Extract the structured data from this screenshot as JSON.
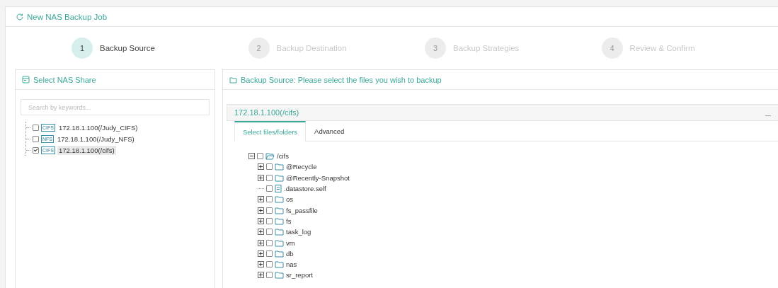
{
  "window": {
    "title": "New NAS Backup Job"
  },
  "steps": [
    {
      "number": "1",
      "label": "Backup Source",
      "selected": true
    },
    {
      "number": "2",
      "label": "Backup Destination",
      "selected": false
    },
    {
      "number": "3",
      "label": "Backup Strategies",
      "selected": false
    },
    {
      "number": "4",
      "label": "Review & Confirm",
      "selected": false
    }
  ],
  "share_panel": {
    "title": "Select NAS Share",
    "search": {
      "placeholder": "Search by keywords..."
    },
    "items": [
      {
        "badge": "CIFS",
        "label": "172.18.1.100(/Judy_CIFS)",
        "checked": false,
        "selected": false
      },
      {
        "badge": "NFS",
        "label": "172.18.1.100(/Judy_NFS)",
        "checked": false,
        "selected": false
      },
      {
        "badge": "CIFS",
        "label": "172.18.1.100(/cifs)",
        "checked": true,
        "selected": true
      }
    ]
  },
  "source_panel": {
    "title": "Backup Source: Please select the files you wish to backup",
    "share_title": "172.18.1.100(/cifs)",
    "tabs": [
      {
        "label": "Select files/folders",
        "selected": true
      },
      {
        "label": "Advanced",
        "selected": false
      }
    ],
    "tree": [
      {
        "label": "/cifs",
        "kind": "folder",
        "expanded": true,
        "checked": false,
        "children": [
          {
            "label": "@Recycle",
            "kind": "folder",
            "expanded": false,
            "checked": false
          },
          {
            "label": "@Recently-Snapshot",
            "kind": "folder",
            "expanded": false,
            "checked": false
          },
          {
            "label": ".datastore.self",
            "kind": "file",
            "checked": false
          },
          {
            "label": "os",
            "kind": "folder",
            "expanded": false,
            "checked": false
          },
          {
            "label": "fs_passfile",
            "kind": "folder",
            "expanded": false,
            "checked": false
          },
          {
            "label": "fs",
            "kind": "folder",
            "expanded": false,
            "checked": false
          },
          {
            "label": "task_log",
            "kind": "folder",
            "expanded": false,
            "checked": false
          },
          {
            "label": "vm",
            "kind": "folder",
            "expanded": false,
            "checked": false
          },
          {
            "label": "db",
            "kind": "folder",
            "expanded": false,
            "checked": false
          },
          {
            "label": "nas",
            "kind": "folder",
            "expanded": false,
            "checked": false
          },
          {
            "label": "sr_report",
            "kind": "folder",
            "expanded": false,
            "checked": false
          }
        ]
      }
    ]
  }
}
